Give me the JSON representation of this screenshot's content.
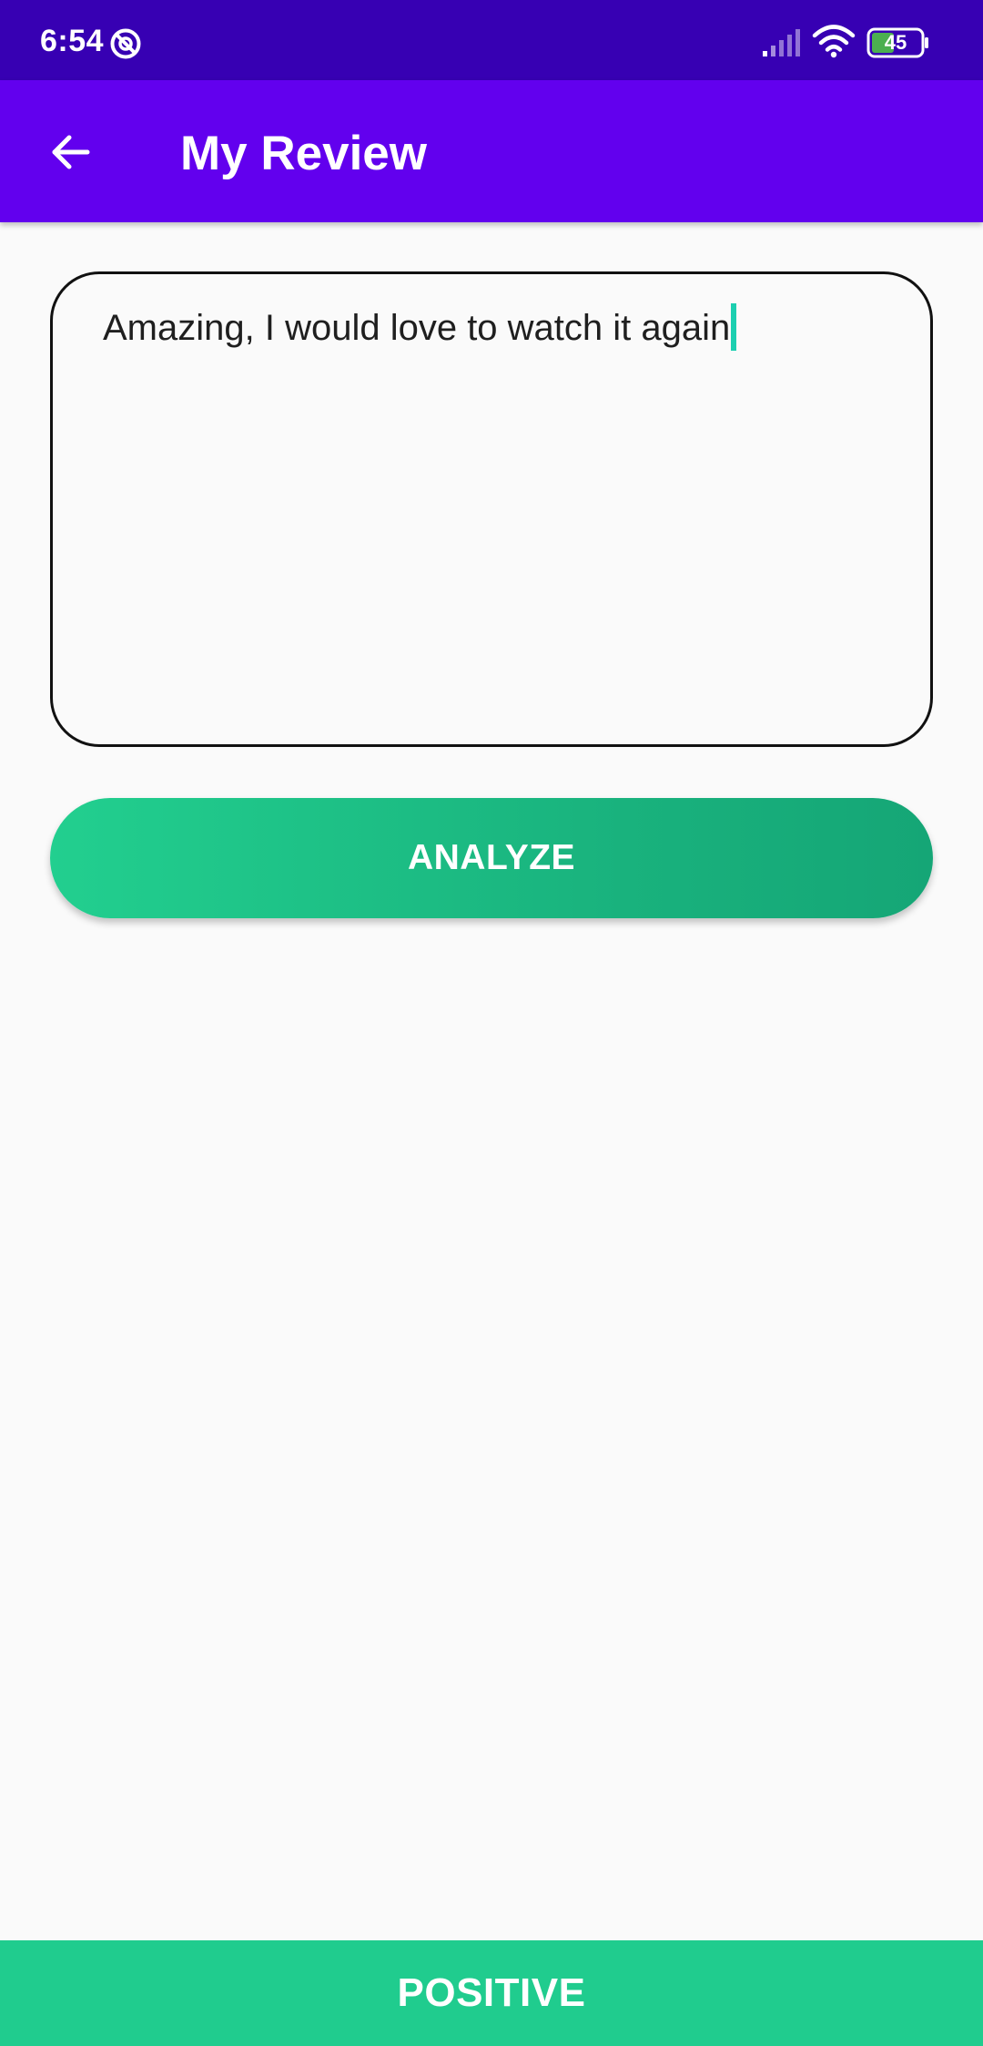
{
  "status_bar": {
    "time": "6:54",
    "battery_level": "45",
    "icons": [
      "do-not-disturb-icon",
      "signal-icon",
      "wifi-icon",
      "battery-icon"
    ]
  },
  "app_bar": {
    "title": "My Review",
    "back_icon": "arrow-left-icon",
    "background": "#6200ee"
  },
  "review_input": {
    "value": "Amazing, I would love to watch it again",
    "cursor_color": "#1ccfb0"
  },
  "analyze_button": {
    "label": "ANALYZE",
    "gradient": [
      "#22cf8f",
      "#15a676"
    ]
  },
  "result": {
    "label": "POSITIVE",
    "background": "#20cc8e"
  },
  "colors": {
    "status_bar": "#3700b3",
    "page_background": "#fafafa"
  }
}
